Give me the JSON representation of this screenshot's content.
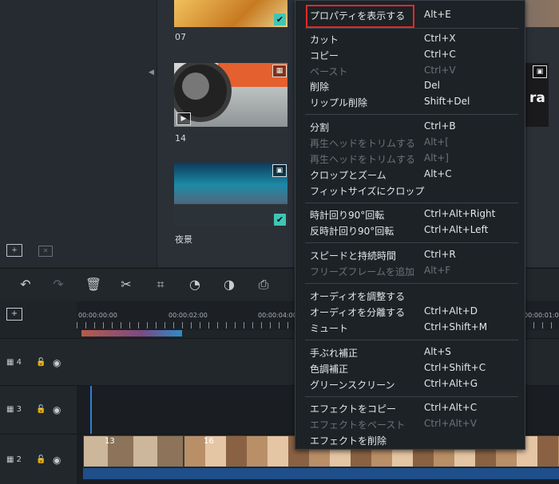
{
  "media": {
    "items": [
      {
        "label": "07",
        "type": "video",
        "checked": true
      },
      {
        "label": "14",
        "type": "video",
        "checked": false
      },
      {
        "label": "夜景",
        "type": "image",
        "checked": true
      }
    ],
    "partial_text": "ra"
  },
  "toolbar": {
    "icons": [
      "undo-icon",
      "redo-icon",
      "delete-icon",
      "cut-icon",
      "crop-icon",
      "speed-icon",
      "color-icon",
      "export-frame-icon"
    ]
  },
  "timeline": {
    "ticks": [
      "00:00:00:00",
      "00:00:02:00",
      "00:00:04:00",
      "00:00:01:0"
    ],
    "tracks": [
      {
        "label": "4"
      },
      {
        "label": "3"
      },
      {
        "label": "2"
      }
    ],
    "clips": [
      {
        "label": "13"
      },
      {
        "label": "16"
      }
    ]
  },
  "context_menu": {
    "groups": [
      [
        {
          "label": "プロパティを表示する",
          "shortcut": "Alt+E",
          "enabled": true,
          "highlighted": true
        }
      ],
      [
        {
          "label": "カット",
          "shortcut": "Ctrl+X",
          "enabled": true
        },
        {
          "label": "コピー",
          "shortcut": "Ctrl+C",
          "enabled": true
        },
        {
          "label": "ペースト",
          "shortcut": "Ctrl+V",
          "enabled": false
        },
        {
          "label": "削除",
          "shortcut": "Del",
          "enabled": true
        },
        {
          "label": "リップル削除",
          "shortcut": "Shift+Del",
          "enabled": true
        }
      ],
      [
        {
          "label": "分割",
          "shortcut": "Ctrl+B",
          "enabled": true
        },
        {
          "label": "再生ヘッドをトリムする",
          "shortcut": "Alt+[",
          "enabled": false
        },
        {
          "label": "再生ヘッドをトリムする",
          "shortcut": "Alt+]",
          "enabled": false
        },
        {
          "label": "クロップとズーム",
          "shortcut": "Alt+C",
          "enabled": true
        },
        {
          "label": "フィットサイズにクロップ",
          "shortcut": "",
          "enabled": true
        }
      ],
      [
        {
          "label": "時計回り90°回転",
          "shortcut": "Ctrl+Alt+Right",
          "enabled": true
        },
        {
          "label": "反時計回り90°回転",
          "shortcut": "Ctrl+Alt+Left",
          "enabled": true
        }
      ],
      [
        {
          "label": "スピードと持続時間",
          "shortcut": "Ctrl+R",
          "enabled": true
        },
        {
          "label": "フリーズフレームを追加",
          "shortcut": "Alt+F",
          "enabled": false
        }
      ],
      [
        {
          "label": "オーディオを調整する",
          "shortcut": "",
          "enabled": true
        },
        {
          "label": "オーディオを分離する",
          "shortcut": "Ctrl+Alt+D",
          "enabled": true
        },
        {
          "label": "ミュート",
          "shortcut": "Ctrl+Shift+M",
          "enabled": true
        }
      ],
      [
        {
          "label": "手ぶれ補正",
          "shortcut": "Alt+S",
          "enabled": true
        },
        {
          "label": "色調補正",
          "shortcut": "Ctrl+Shift+C",
          "enabled": true
        },
        {
          "label": "グリーンスクリーン",
          "shortcut": "Ctrl+Alt+G",
          "enabled": true
        }
      ],
      [
        {
          "label": "エフェクトをコピー",
          "shortcut": "Ctrl+Alt+C",
          "enabled": true
        },
        {
          "label": "エフェクトをペースト",
          "shortcut": "Ctrl+Alt+V",
          "enabled": false
        },
        {
          "label": "エフェクトを削除",
          "shortcut": "",
          "enabled": true
        }
      ]
    ]
  },
  "colors": {
    "accent": "#3ec6b4",
    "highlight_border": "#e02a2a",
    "playhead": "#2f7ed8"
  }
}
